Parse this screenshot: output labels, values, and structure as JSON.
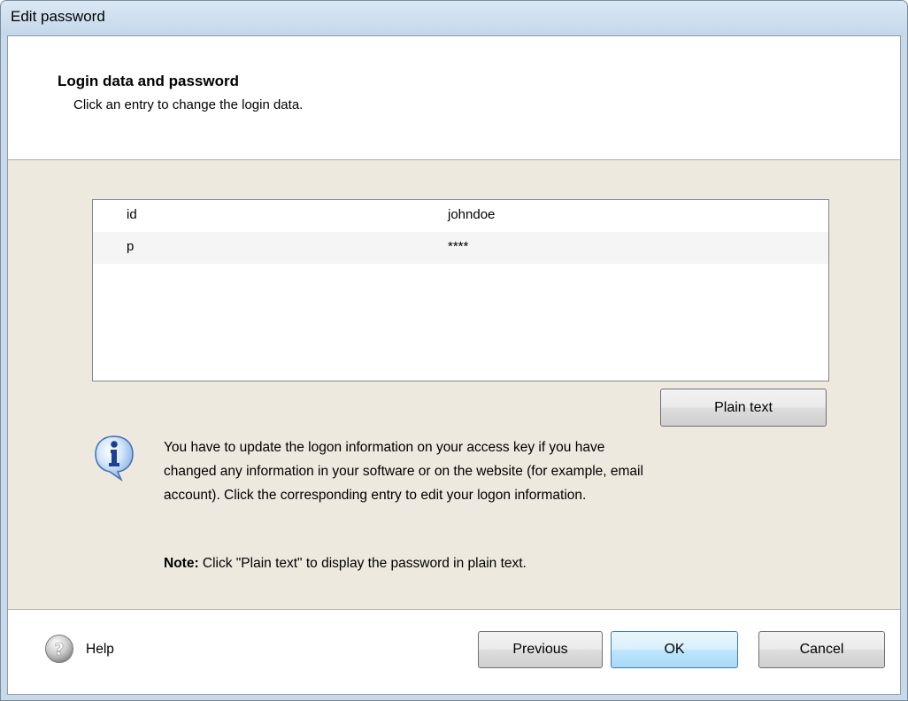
{
  "window": {
    "title": "Edit password"
  },
  "header": {
    "title": "Login data and password",
    "subtitle": "Click an entry to change the login data."
  },
  "entries": [
    {
      "key": "id",
      "value": "johndoe"
    },
    {
      "key": "p",
      "value": "****"
    }
  ],
  "plain_text_button": "Plain text",
  "info": {
    "line1": "You have to update the logon information on your access key if you have",
    "line2": "changed any information in your software or on the website (for example, email",
    "line3": "account). Click the corresponding entry to edit your logon information."
  },
  "note": {
    "label": "Note:",
    "text": " Click \"Plain text\" to display the password in plain text."
  },
  "footer": {
    "help": "Help",
    "previous": "Previous",
    "ok": "OK",
    "cancel": "Cancel"
  },
  "icons": {
    "info": "info-icon",
    "help": "help-icon"
  },
  "colors": {
    "panel_background": "#eee9df",
    "default_button": "#bee6fd"
  }
}
